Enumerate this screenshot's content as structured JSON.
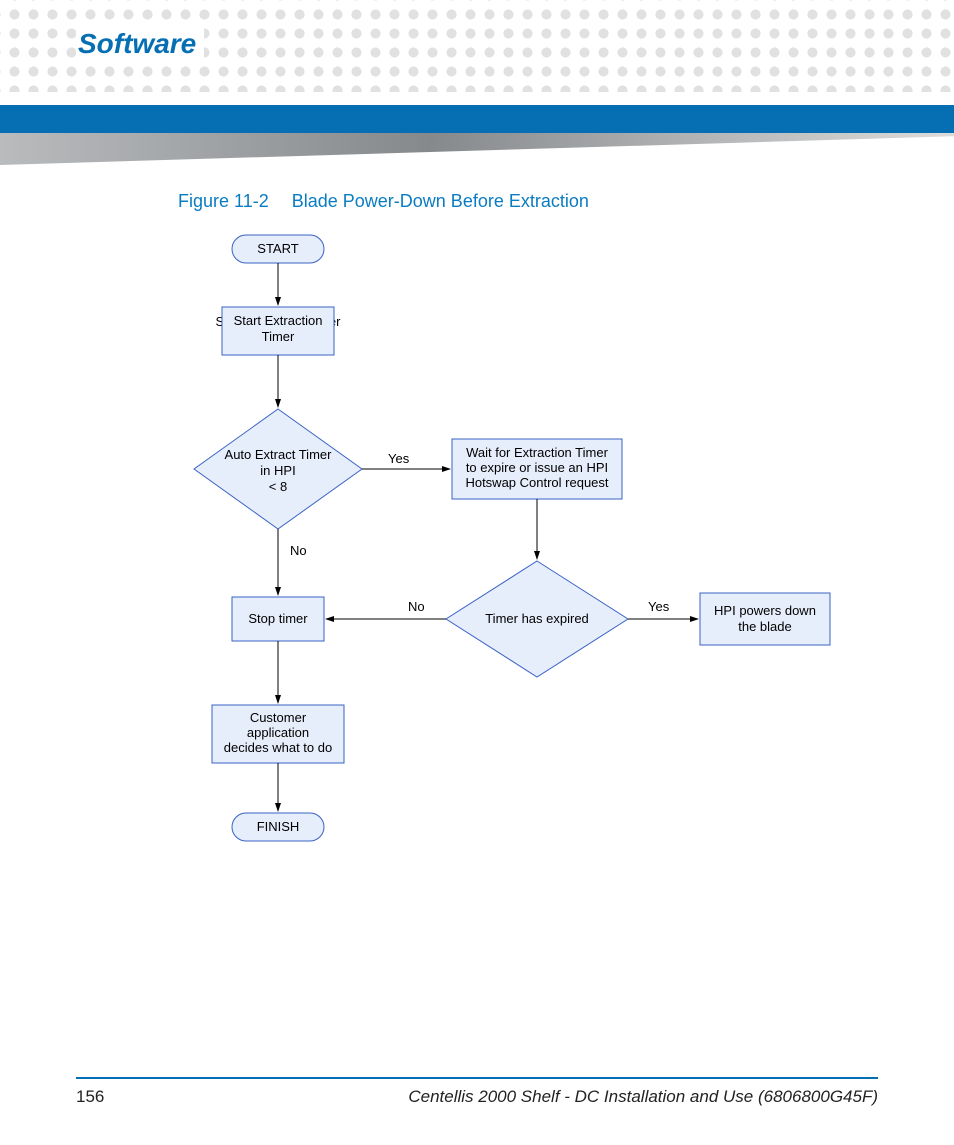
{
  "header": {
    "section": "Software"
  },
  "figure": {
    "label": "Figure 11-2",
    "title": "Blade Power-Down Before Extraction"
  },
  "flow": {
    "start": "START",
    "finish": "FINISH",
    "box_start_timer": "Start Extraction Timer",
    "dec_auto_extract_l1": "Auto Extract Timer",
    "dec_auto_extract_l2": "in HPI",
    "dec_auto_extract_l3": "< 8",
    "box_wait_l1": "Wait for Extraction Timer",
    "box_wait_l2": "to expire or issue an HPI",
    "box_wait_l3": "Hotswap Control request",
    "box_stop_timer": "Stop timer",
    "dec_timer_expired": "Timer has expired",
    "box_hpi_powers_l1": "HPI powers down",
    "box_hpi_powers_l2": "the blade",
    "box_customer_l1": "Customer",
    "box_customer_l2": "application",
    "box_customer_l3": "decides what to do",
    "yes": "Yes",
    "no": "No"
  },
  "footer": {
    "page": "156",
    "doc": "Centellis 2000 Shelf - DC Installation and Use (6806800G45F)"
  }
}
